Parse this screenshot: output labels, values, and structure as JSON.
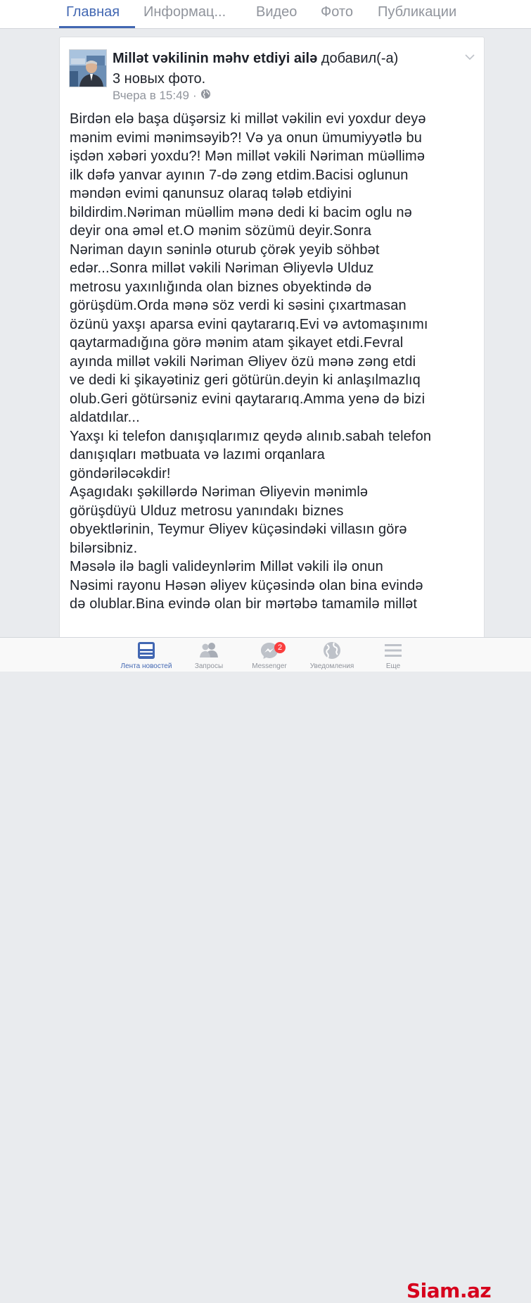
{
  "tabs": [
    {
      "label": "Главная",
      "active": true
    },
    {
      "label": "Информац..."
    },
    {
      "label": "Видео"
    },
    {
      "label": "Фото"
    },
    {
      "label": "Публикации"
    }
  ],
  "post": {
    "page_name": "Millət vəkilinin məhv etdiyi ailə",
    "action": "добавил(-а)",
    "photo_count": "3 новых фото.",
    "timestamp": "Вчера в 15:49",
    "separator": "·",
    "privacy_icon": "globe-icon",
    "text": "Birdən elə başa düşərsiz ki millət vəkilin evi yoxdur deyə\nmənim evimi mənimsəyib?! Və ya onun ümumiyyətlə bu\nişdən xəbəri yoxdu?! Mən millət vəkili Nəriman müəllimə\nilk dəfə yanvar ayının 7-də zəng etdim.Bacisi oglunun\nməndən evimi qanunsuz olaraq tələb etdiyini\nbildirdim.Nəriman müəllim mənə dedi ki bacim oglu nə\ndeyir ona əməl et.O mənim sözümü deyir.Sonra\nNəriman dayın səninlə oturub çörək yeyib söhbət\nedər...Sonra millət vəkili Nəriman Əliyevlə Ulduz\nmetrosu yaxınlığında olan biznes obyektində də\ngörüşdüm.Orda mənə söz verdi ki səsini çıxartmasan\nözünü yaxşı aparsa evini qaytararıq.Evi və avtomaşınımı\nqaytarmadığına görə mənim atam şikayet etdi.Fevral\nayında millət vəkili Nəriman Əliyev özü mənə zəng etdi\nve dedi ki şikayətiniz geri götürün.deyin ki anlaşılmazlıq\nolub.Geri götürsəniz evini qaytararıq.Amma yenə də bizi\naldatdılar...\nYaxşı ki telefon danışıqlarımız qeydə alınıb.sabah telefon\ndanışıqları mətbuata və lazımi orqanlara\ngöndəriləcəkdir!\nAşagıdakı şəkillərdə Nəriman Əliyevin mənimlə\ngörüşdüyü Ulduz metrosu yanındakı biznes\nobyektlərinin, Teymur Əliyev küçəsindəki villasın görə\nbilərsibniz.\nMəsələ ilə bagli valideynlərim Millət vəkili ilə onun\nNəsimi rayonu Həsən əliyev küçəsində olan bina evində\ndə olublar.Bina evində olan bir mərtəbə tamamilə millət"
  },
  "bottom_nav": [
    {
      "label": "Лента новостей",
      "icon": "news-feed-icon",
      "active": true
    },
    {
      "label": "Запросы",
      "icon": "friend-requests-icon"
    },
    {
      "label": "Messenger",
      "icon": "messenger-icon",
      "badge": "2"
    },
    {
      "label": "Уведомления",
      "icon": "notifications-globe-icon"
    },
    {
      "label": "Еще",
      "icon": "menu-icon"
    }
  ],
  "watermark": {
    "text": "Siam.az"
  },
  "colors": {
    "accent": "#4267b2",
    "muted": "#90949c",
    "badge": "#fa3e3e",
    "watermark": "#d6001c"
  }
}
